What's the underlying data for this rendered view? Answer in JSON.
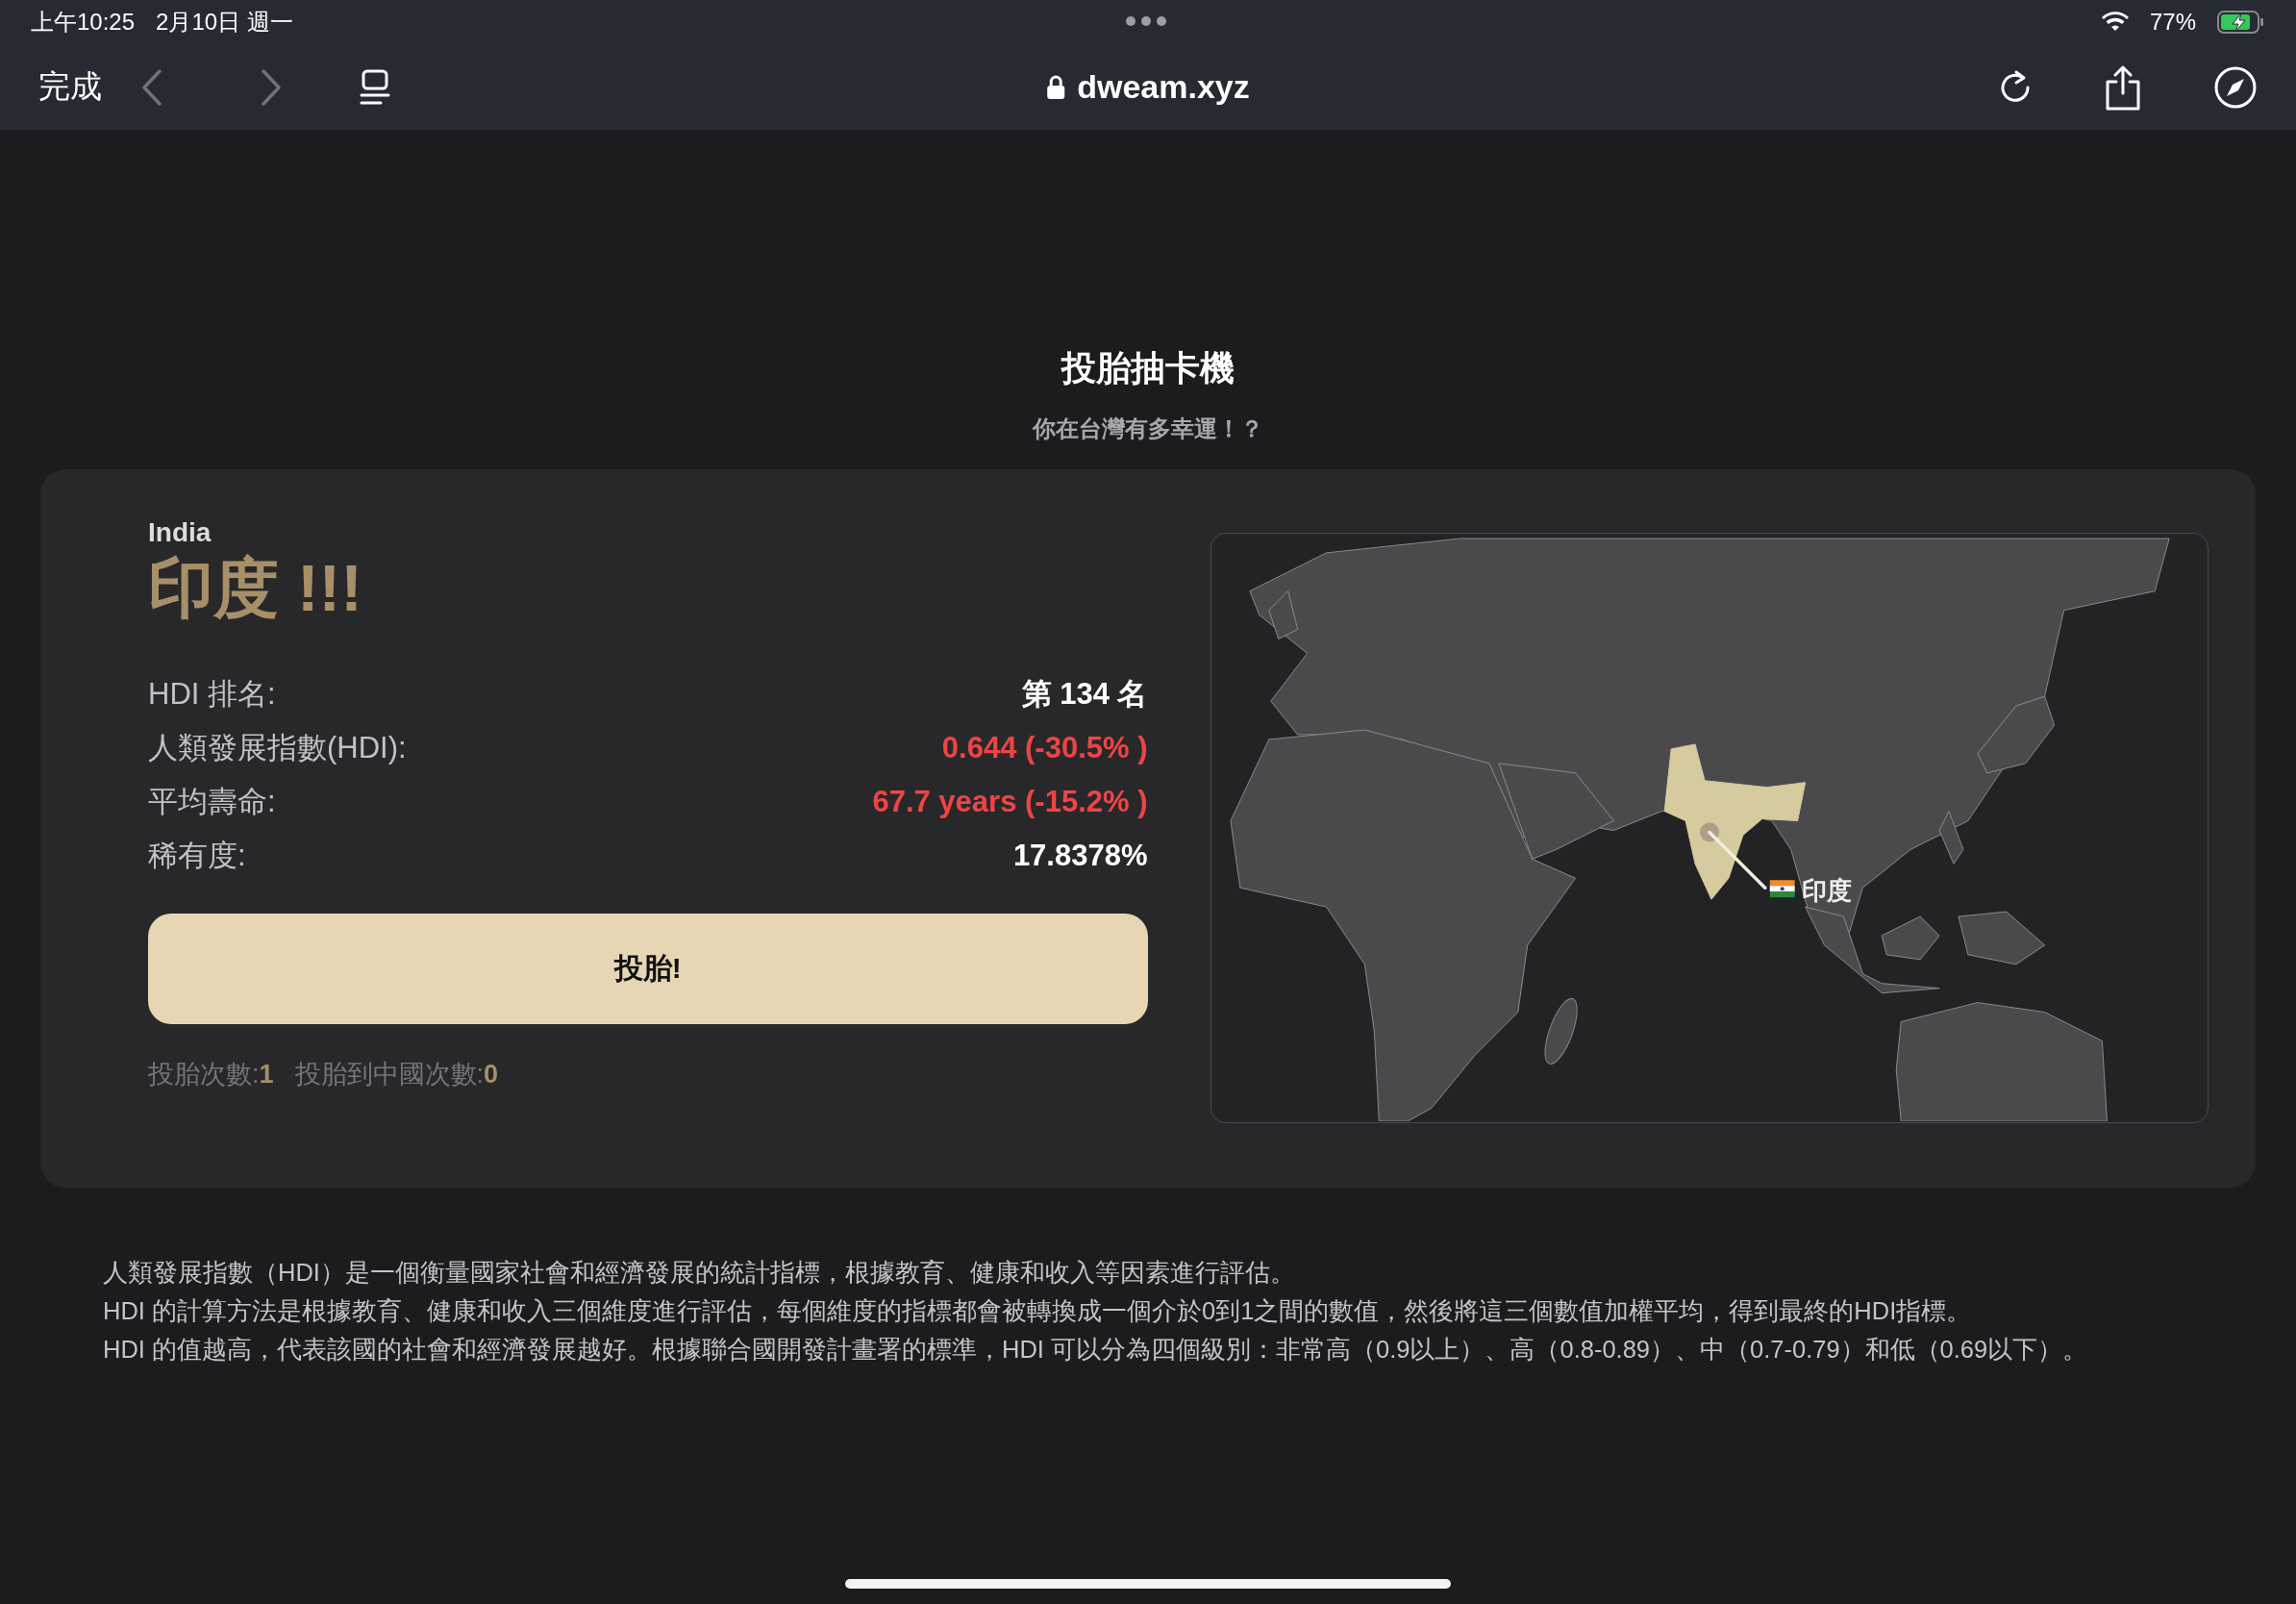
{
  "status_bar": {
    "time": "上午10:25",
    "date": "2月10日 週一",
    "battery": "77%"
  },
  "browser": {
    "done": "完成",
    "url": "dweam.xyz"
  },
  "header": {
    "title": "投胎抽卡機",
    "subtitle": "你在台灣有多幸運！？"
  },
  "result": {
    "country_en": "India",
    "country": "印度 !!!",
    "stats": [
      {
        "label": "HDI 排名:",
        "value": "第 134 名",
        "color": "#ffffff"
      },
      {
        "label": "人類發展指數(HDI):",
        "value": "0.644 (-30.5% )",
        "color": "#ef4444"
      },
      {
        "label": "平均壽命:",
        "value": "67.7 years (-15.2% )",
        "color": "#ef4444"
      },
      {
        "label": "稀有度:",
        "value": "17.8378%",
        "color": "#ffffff"
      }
    ],
    "button": "投胎!",
    "counters": [
      "投胎次數:**1**",
      "投胎到中國次數:**0**"
    ],
    "map": {
      "label": "印度"
    }
  },
  "notes": [
    "人類發展指數（HDI）是一個衡量國家社會和經濟發展的統計指標，根據教育、健康和收入等因素進行評估。",
    "HDI 的計算方法是根據教育、健康和收入三個維度進行評估，每個維度的指標都會被轉換成一個介於0到1之間的數值，然後將這三個數值加權平均，得到最終的HDI指標。",
    "HDI 的值越高，代表該國的社會和經濟發展越好。根據聯合國開發計畫署的標準，HDI 可以分為四個級別：非常高（0.9以上）、高（0.8-0.89）、中（0.7-0.79）和低（0.69以下）。"
  ]
}
